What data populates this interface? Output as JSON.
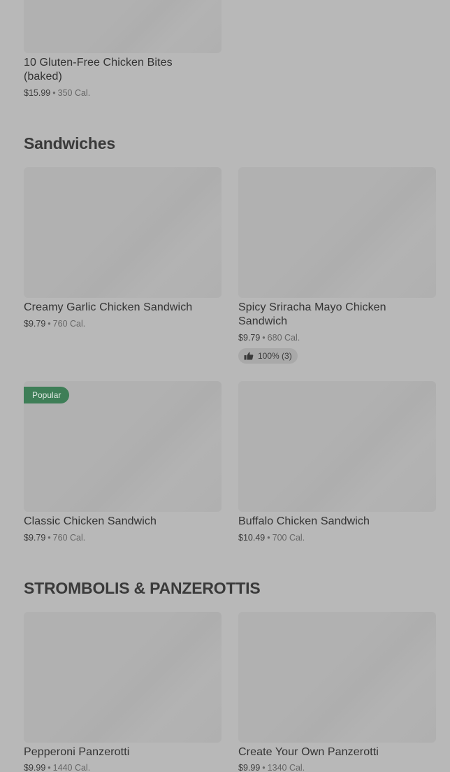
{
  "top_item": {
    "title": "10 Gluten-Free Chicken Bites (baked)",
    "price": "$15.99",
    "separator": "•",
    "calories": "350 Cal."
  },
  "sections": [
    {
      "title": "Sandwiches",
      "items": [
        {
          "title": "Creamy Garlic Chicken Sandwich",
          "price": "$9.79",
          "calories": "760 Cal."
        },
        {
          "title": "Spicy Sriracha Mayo Chicken Sandwich",
          "price": "$9.79",
          "calories": "680 Cal.",
          "rating": "100% (3)",
          "rating_icon": "thumbs-up-icon"
        },
        {
          "title": "Classic Chicken Sandwich",
          "price": "$9.79",
          "calories": "760 Cal.",
          "badge": "Popular"
        },
        {
          "title": "Buffalo Chicken Sandwich",
          "price": "$10.49",
          "calories": "700 Cal."
        }
      ]
    },
    {
      "title": "STROMBOLIS & PANZEROTTIS",
      "items": [
        {
          "title": "Pepperoni Panzerotti",
          "price": "$9.99",
          "calories": "1440 Cal."
        },
        {
          "title": "Create Your Own Panzerotti",
          "price": "$9.99",
          "calories": "1340 Cal."
        }
      ]
    }
  ],
  "colors": {
    "background": "#b8b8b8",
    "popular_badge": "#3e7e57"
  }
}
